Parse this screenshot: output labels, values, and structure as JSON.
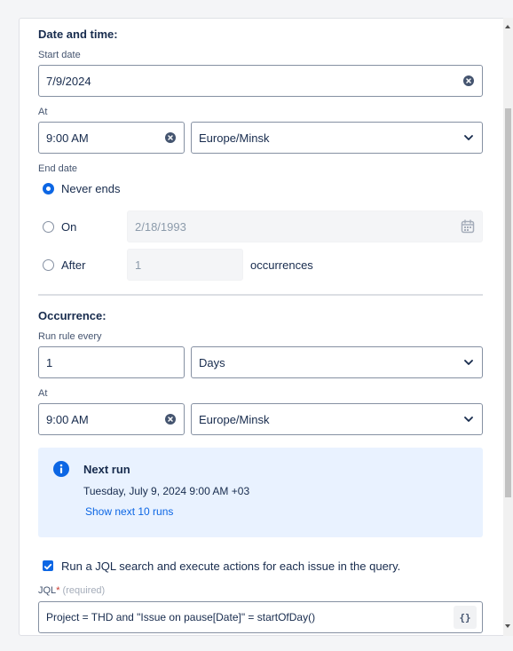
{
  "date_time": {
    "section_title": "Date and time:",
    "start_date_label": "Start date",
    "start_date_value": "7/9/2024",
    "at_label": "At",
    "time_value": "9:00 AM",
    "timezone_value": "Europe/Minsk"
  },
  "end_date": {
    "label": "End date",
    "options": [
      {
        "label": "Never ends",
        "selected": true
      },
      {
        "label": "On",
        "selected": false
      },
      {
        "label": "After",
        "selected": false
      }
    ],
    "on_date_placeholder": "2/18/1993",
    "after_count_placeholder": "1",
    "occurrences_label": "occurrences"
  },
  "occurrence": {
    "section_title": "Occurrence:",
    "run_rule_label": "Run rule every",
    "interval_value": "1",
    "unit_value": "Days",
    "at_label": "At",
    "time_value": "9:00 AM",
    "timezone_value": "Europe/Minsk"
  },
  "next_run": {
    "title": "Next run",
    "datetime": "Tuesday, July 9, 2024 9:00 AM +03",
    "link_label": "Show next 10 runs"
  },
  "jql": {
    "checkbox_label": "Run a JQL search and execute actions for each issue in the query.",
    "checkbox_checked": true,
    "label": "JQL",
    "required_mark": "*",
    "required_hint": "(required)",
    "value": "Project = THD and \"Issue on pause[Date]\" = startOfDay()",
    "button_label": "{}"
  },
  "colors": {
    "accent": "#0c66e4",
    "info_bg": "#e9f2ff",
    "required": "#c9372c"
  }
}
